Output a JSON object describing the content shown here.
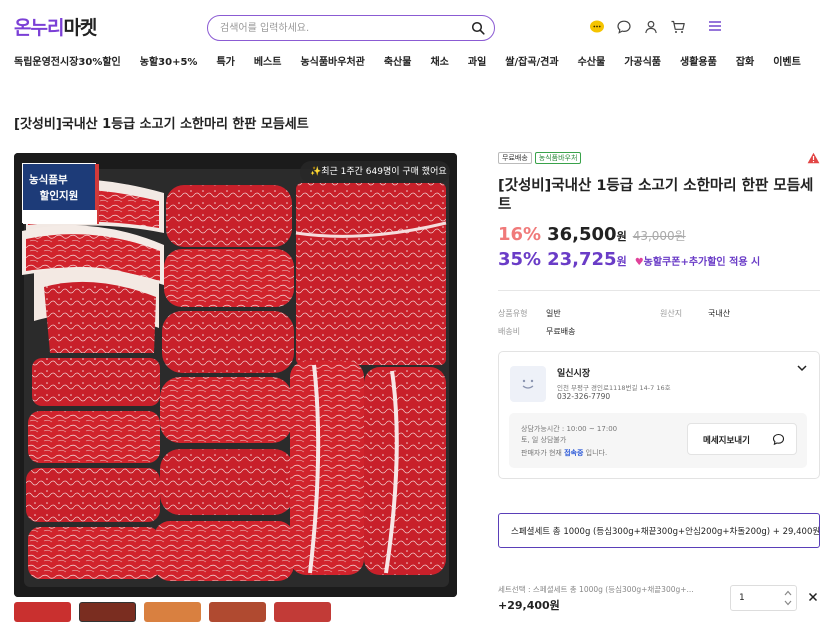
{
  "header": {
    "logo": {
      "part1": "온누리",
      "part2": "마켓"
    },
    "search_placeholder": "검색어를 입력하세요.",
    "icons": [
      "chat-bubble-icon",
      "message-icon",
      "user-icon",
      "cart-icon",
      "menu-icon"
    ]
  },
  "nav": {
    "items": [
      "독립운영전시장30%할인",
      "농할30+5%",
      "특가",
      "베스트",
      "농식품바우처관",
      "축산물",
      "채소",
      "과일",
      "쌀/잡곡/견과",
      "수산물",
      "가공식품",
      "생활용품",
      "잡화",
      "이벤트"
    ]
  },
  "product": {
    "page_title": "[갓성비]국내산 1등급 소고기 소한마리 한판 모듬세트",
    "image": {
      "badge_line1": "농식품부",
      "badge_line2": "할인지원",
      "buy_chip": "✨최근 1주간 649명이 구매 했어요"
    },
    "tags": [
      "무료배송",
      "농식품바우처"
    ],
    "title": "[갓성비]국내산 1등급 소고기 소한마리 한판 모듬세트",
    "discount1": "16%",
    "price1": "36,500",
    "won": "원",
    "original_price": "43,000원",
    "discount2": "35%",
    "price2": "23,725",
    "coupon_note": "농할쿠폰+추가할인 적용 시",
    "specs": {
      "type_label": "상품유형",
      "type_value": "일반",
      "origin_label": "원산지",
      "origin_value": "국내산",
      "ship_label": "배송비",
      "ship_value": "무료배송"
    }
  },
  "seller": {
    "name": "일신시장",
    "address": "인천 부평구 경인로1118번길 14-7 16호",
    "tel": "032-326-7790",
    "hours": "상담가능시간 : 10:00 ~ 17:00",
    "closed": "토, 일 상담불가",
    "status_prefix": "판매자가 현재",
    "status_value": "접속중",
    "status_suffix": "입니다.",
    "message_button": "메세지보내기"
  },
  "option": {
    "selected": "스페셜세트 총 1000g (등심300g+채끝300g+안심200g+차돌200g)  + 29,400원",
    "summary_label": "세트선택 : 스페셜세트 총 1000g (등심300g+채끝300g+...",
    "summary_price": "+29,400원",
    "quantity": "1"
  },
  "colors": {
    "brand_purple": "#6a3cc7",
    "discount_red": "#f07a7a",
    "logo_yellow": "#e2a21b"
  }
}
